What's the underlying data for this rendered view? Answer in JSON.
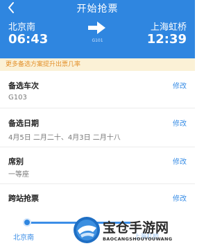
{
  "header": {
    "title": "开始抢票",
    "departure": {
      "station": "北京南",
      "time": "06:43"
    },
    "arrival": {
      "station": "上海虹桥",
      "time": "12:39"
    },
    "train_number": "G101"
  },
  "notice": "更多备选方案提升出票几率",
  "rows": [
    {
      "title": "备选车次",
      "value": "G103",
      "action": "修改"
    },
    {
      "title": "备选日期",
      "value": "4月5日 二月二十、4月3日 二月十八",
      "action": "修改"
    },
    {
      "title": "席别",
      "value": "一等座",
      "action": "修改"
    },
    {
      "title": "跨站抢票",
      "value": "",
      "action": "修改"
    }
  ],
  "stops": {
    "start": "北京南",
    "end": "上海虹桥"
  },
  "watermark": {
    "title": "宝仓手游网",
    "subtitle": "BAOCANGSHOUYOUWANG"
  },
  "colors": {
    "brand": "#2f86e0",
    "notice_bg": "#fbf1d6",
    "notice_text": "#e3912c",
    "link": "#3a8ee6"
  }
}
